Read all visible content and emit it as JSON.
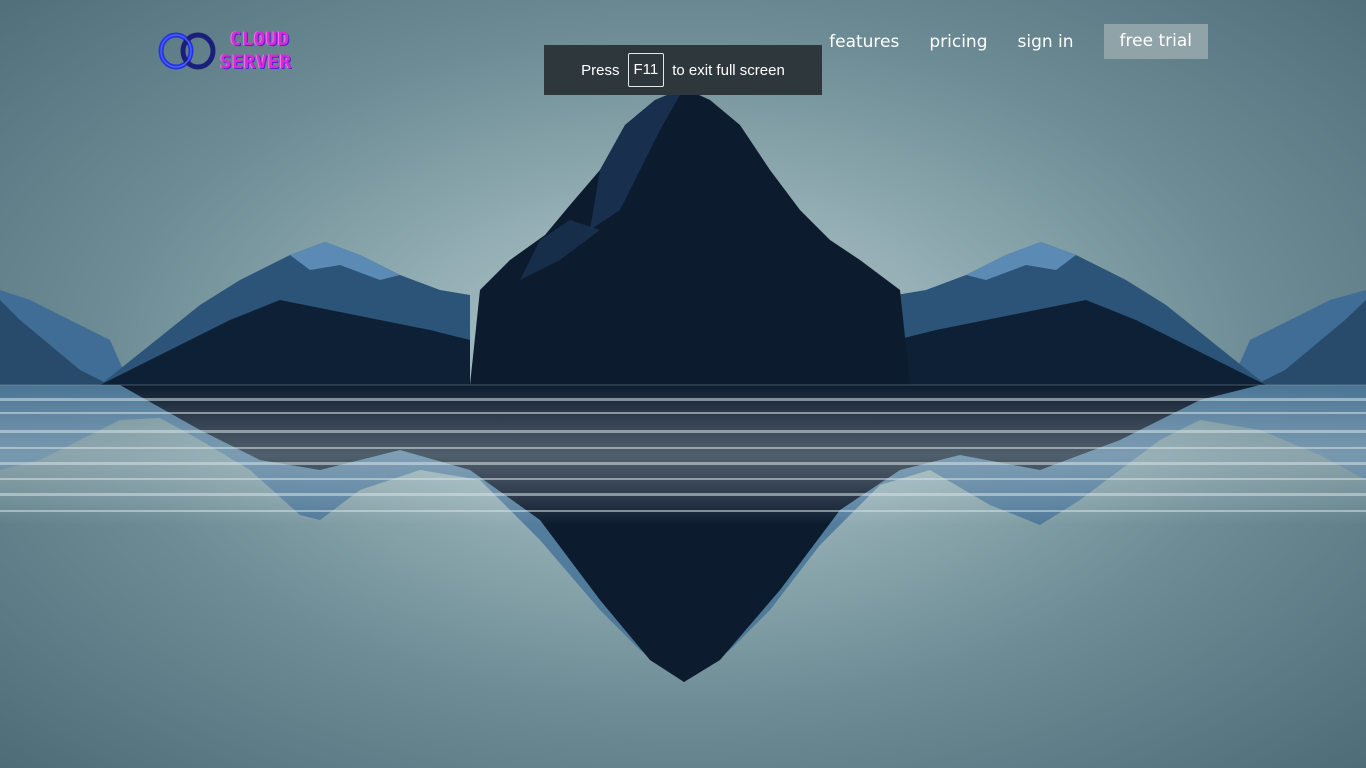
{
  "logo": {
    "line1": "CLOUD",
    "line2": "SERVER"
  },
  "nav": {
    "items": [
      {
        "label": "features"
      },
      {
        "label": "pricing"
      },
      {
        "label": "sign in"
      }
    ],
    "cta_label": "free trial"
  },
  "fullscreen_toast": {
    "before": "Press",
    "key": "F11",
    "after": "to exit full screen"
  },
  "colors": {
    "mountain_dark": "#0c1b2e",
    "mountain_face": "#3f6d96",
    "cta_bg": "#8fa3a9",
    "logo_text": "#d12fd1",
    "logo_rings": "#2233e0"
  }
}
